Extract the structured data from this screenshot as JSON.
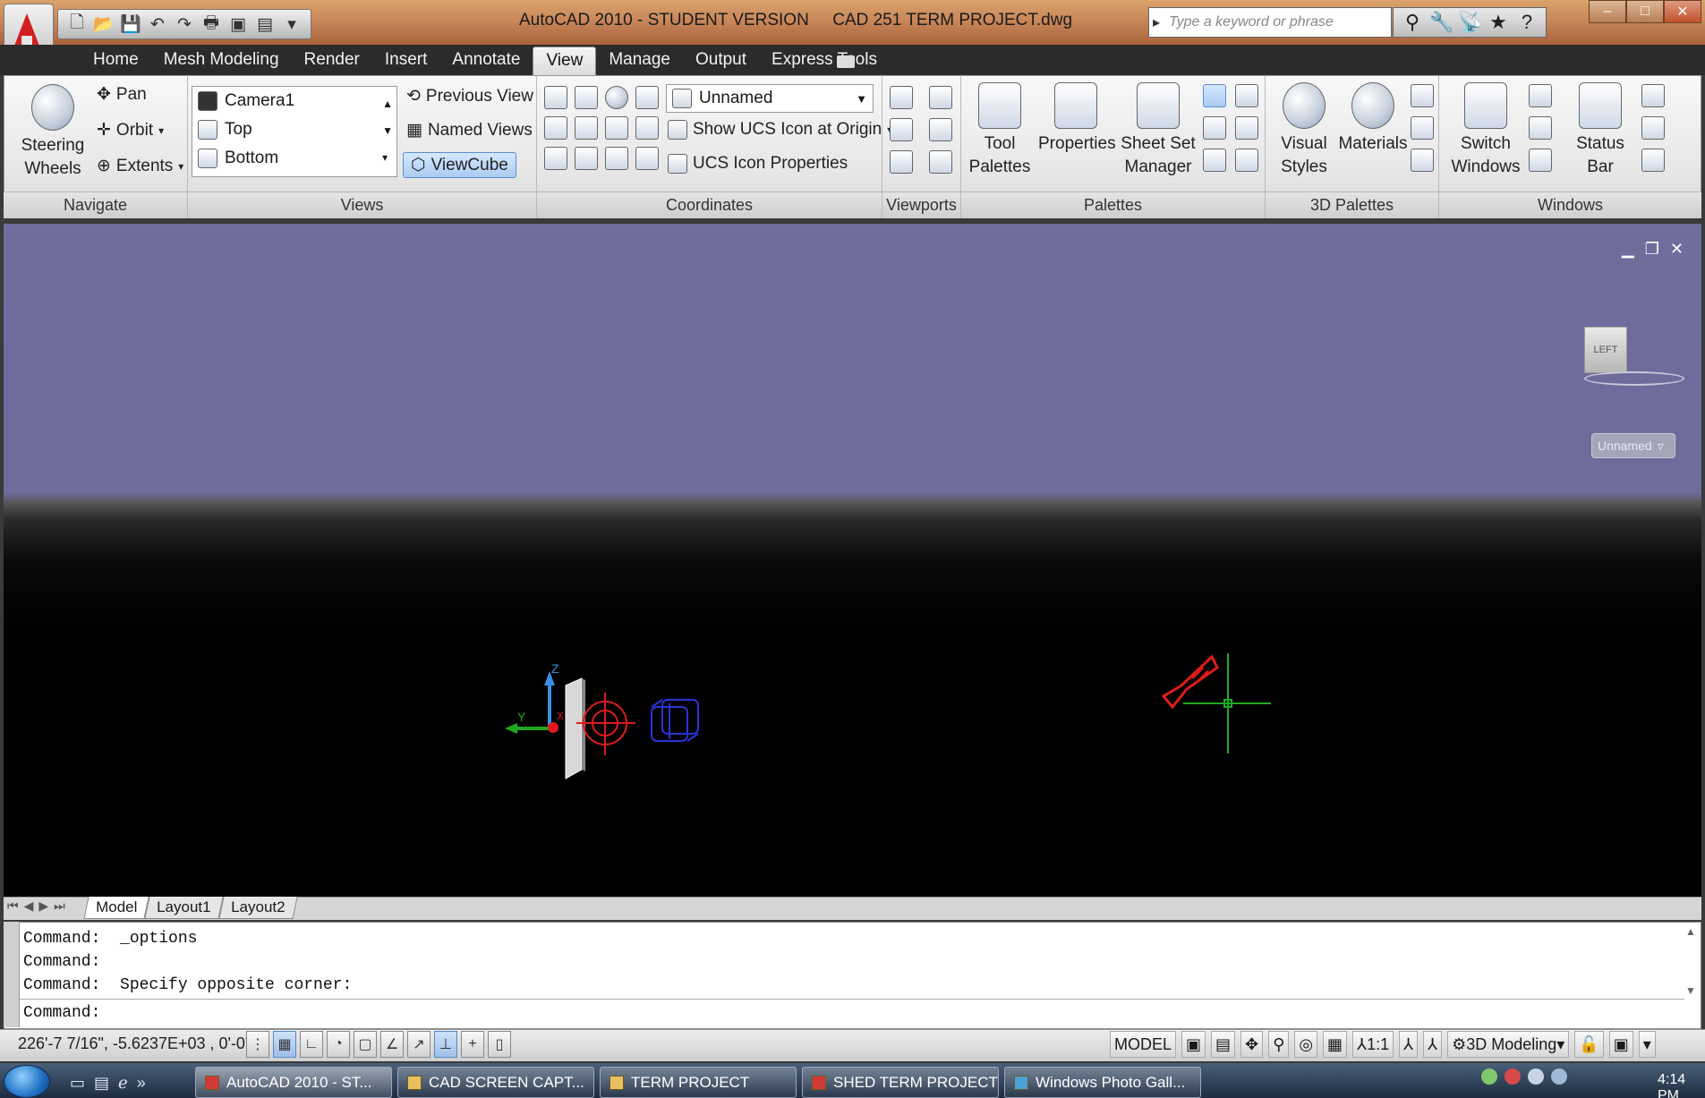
{
  "window": {
    "app_title": "AutoCAD 2010 - STUDENT VERSION     CAD 251 TERM PROJECT.dwg",
    "search_placeholder": "Type a keyword or phrase"
  },
  "ribbon_tabs": [
    "Home",
    "Mesh Modeling",
    "Render",
    "Insert",
    "Annotate",
    "View",
    "Manage",
    "Output",
    "Express Tools"
  ],
  "active_tab": "View",
  "panels": {
    "navigate": {
      "label": "Navigate",
      "steering_wheels_l1": "Steering",
      "steering_wheels_l2": "Wheels",
      "pan": "Pan",
      "orbit": "Orbit",
      "extents": "Extents"
    },
    "views": {
      "label": "Views",
      "items": [
        "Camera1",
        "Top",
        "Bottom"
      ],
      "previous_view": "Previous View",
      "named_views": "Named Views",
      "viewcube": "ViewCube"
    },
    "coordinates": {
      "label": "Coordinates",
      "ucs_combo": "Unnamed",
      "show_ucs_icon": "Show UCS Icon at Origin",
      "ucs_icon_properties": "UCS Icon Properties"
    },
    "viewports": {
      "label": "Viewports"
    },
    "palettes": {
      "label": "Palettes",
      "tool_palettes_l1": "Tool",
      "tool_palettes_l2": "Palettes",
      "properties": "Properties",
      "sheet_set_l1": "Sheet Set",
      "sheet_set_l2": "Manager"
    },
    "palettes3d": {
      "label": "3D Palettes",
      "visual_styles_l1": "Visual",
      "visual_styles_l2": "Styles",
      "materials": "Materials"
    },
    "windows": {
      "label": "Windows",
      "switch_windows_l1": "Switch",
      "switch_windows_l2": "Windows",
      "status_bar_l1": "Status",
      "status_bar_l2": "Bar"
    }
  },
  "viewport": {
    "viewcube_face": "LEFT",
    "named_ucs": "Unnamed",
    "ucs_x": "X",
    "ucs_y": "Y",
    "ucs_z": "Z"
  },
  "layout_tabs": [
    "Model",
    "Layout1",
    "Layout2"
  ],
  "command": {
    "history": [
      "Command:  _options",
      "Command:",
      "Command:  Specify opposite corner:"
    ],
    "prompt": "Command:"
  },
  "status": {
    "coords": "226'-7 7/16\", -5.6237E+03 , 0'-0\"",
    "model": "MODEL",
    "annotation_scale": "1:1",
    "workspace": "3D Modeling"
  },
  "taskbar": {
    "items": [
      "AutoCAD 2010 - ST...",
      "CAD SCREEN CAPT...",
      "TERM PROJECT",
      "SHED TERM PROJECT",
      "Windows Photo Gall..."
    ],
    "clock": "4:14 PM"
  }
}
